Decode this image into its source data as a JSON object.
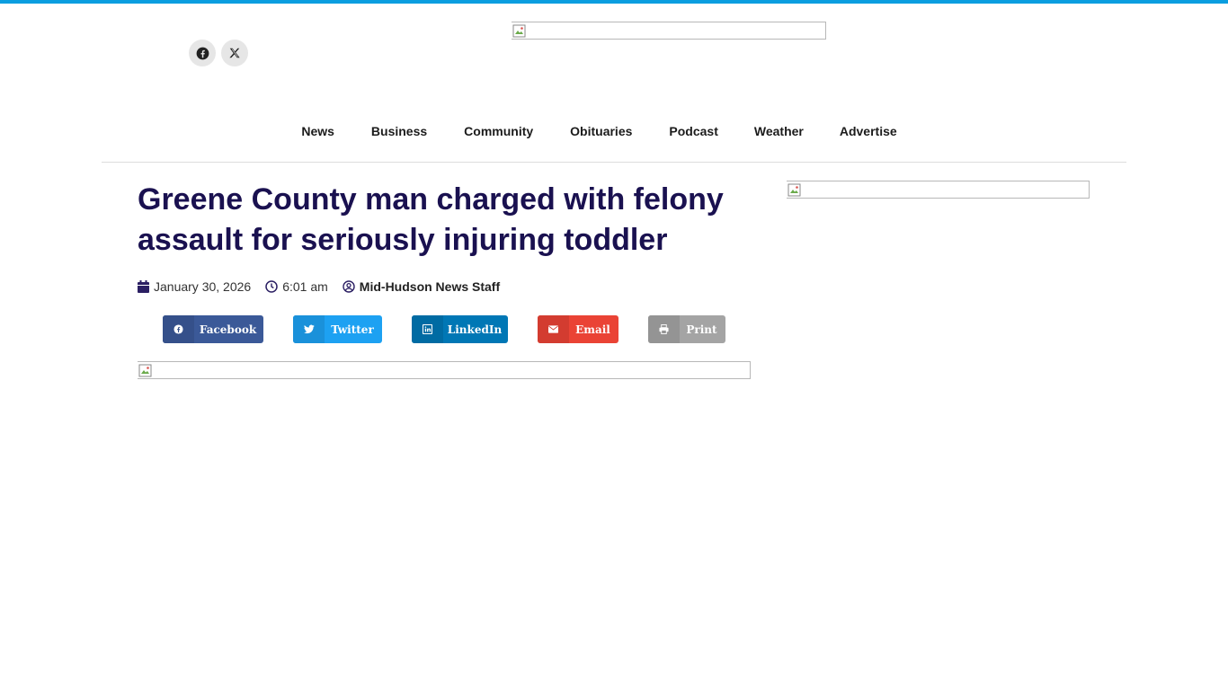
{
  "header": {
    "social": [
      {
        "icon": "facebook-icon"
      },
      {
        "icon": "x-twitter-icon"
      }
    ]
  },
  "nav": {
    "items": [
      {
        "label": "News"
      },
      {
        "label": "Business"
      },
      {
        "label": "Community"
      },
      {
        "label": "Obituaries"
      },
      {
        "label": "Podcast"
      },
      {
        "label": "Weather"
      },
      {
        "label": "Advertise"
      }
    ]
  },
  "article": {
    "title": "Greene County man charged with felony assault for seriously injuring toddler",
    "date": "January 30, 2026",
    "time": "6:01 am",
    "author": "Mid-Hudson News Staff"
  },
  "share": {
    "buttons": [
      {
        "label": "Facebook",
        "icon": "facebook-icon",
        "color": "#3b5998",
        "icon_bg": "#35508a"
      },
      {
        "label": "Twitter",
        "icon": "twitter-icon",
        "color": "#1da1f2",
        "icon_bg": "#1a91da"
      },
      {
        "label": "LinkedIn",
        "icon": "linkedin-icon",
        "color": "#0077b5",
        "icon_bg": "#006ba3"
      },
      {
        "label": "Email",
        "icon": "envelope-icon",
        "color": "#ea4335",
        "icon_bg": "#d33c30"
      },
      {
        "label": "Print",
        "icon": "printer-icon",
        "color": "#a4a4a4",
        "icon_bg": "#949494"
      }
    ]
  },
  "colors": {
    "accent_bar": "#0a9ee0",
    "headline": "#1a1150",
    "meta_icon": "#2b1f63"
  }
}
